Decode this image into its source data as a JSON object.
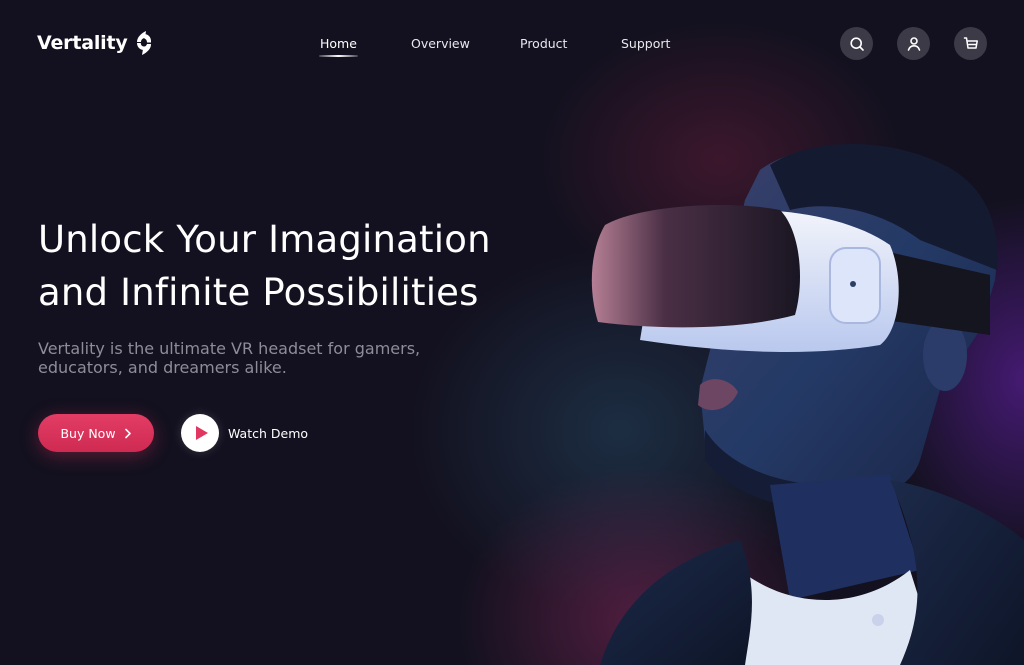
{
  "brand": {
    "name": "Vertality",
    "logo_icon": "split-circle-logo-icon"
  },
  "nav": {
    "items": [
      {
        "label": "Home",
        "active": true
      },
      {
        "label": "Overview",
        "active": false
      },
      {
        "label": "Product",
        "active": false
      },
      {
        "label": "Support",
        "active": false
      }
    ]
  },
  "header_actions": {
    "search": {
      "icon": "search-icon"
    },
    "account": {
      "icon": "user-icon"
    },
    "cart": {
      "icon": "cart-icon"
    }
  },
  "hero": {
    "title_lines": [
      "Unlock Your Imagination",
      "and Infinite Possibilities"
    ],
    "subtitle_lines": [
      "Vertality is the ultimate VR headset for gamers,",
      "educators, and dreamers alike."
    ],
    "primary_button": {
      "label": "Buy Now",
      "icon": "chevron-right-icon"
    },
    "secondary_button": {
      "label": "Watch Demo",
      "icon": "play-icon"
    },
    "image_alt": "Man wearing a white VR headset in neon lighting"
  },
  "colors": {
    "background": "#13111f",
    "accent": "#e0365f",
    "icon_button_bg": "#3c3a47",
    "muted_text": "#8e8c99"
  }
}
